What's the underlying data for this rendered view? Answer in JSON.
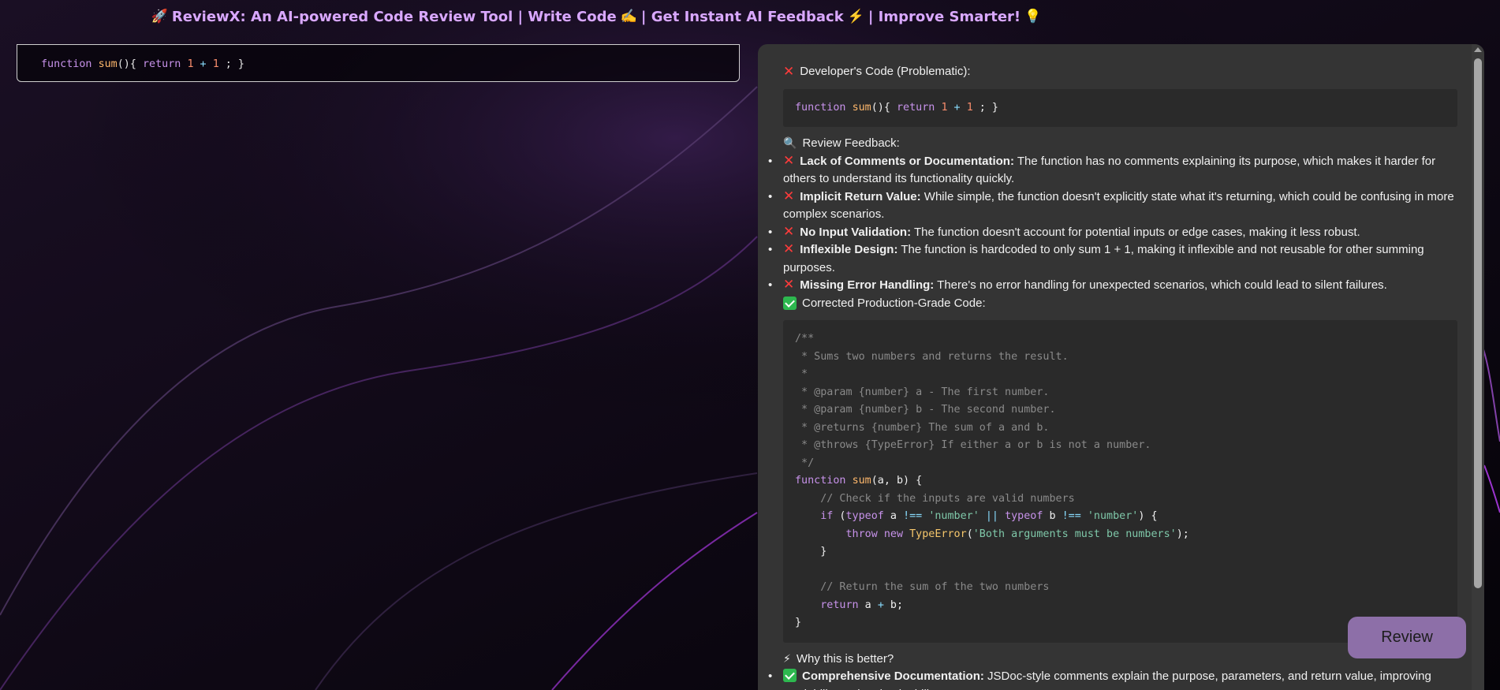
{
  "header": {
    "rocket_icon": "🚀",
    "title_text": "ReviewX: An AI-powered Code Review Tool | Write Code",
    "writing_icon": "✍️",
    "feedback_text": "| Get Instant AI Feedback",
    "lightning_icon": "⚡",
    "improve_text": "| Improve Smarter!",
    "bulb_icon": "💡"
  },
  "editor": {
    "code_tokens": [
      "function ",
      "sum",
      "(){ ",
      "return ",
      "1",
      " + ",
      "1",
      " ; }"
    ]
  },
  "review": {
    "developers_code_heading": "Developer's Code (Problematic):",
    "developers_code_tokens": [
      "function ",
      "sum",
      "(){ ",
      "return ",
      "1",
      " + ",
      "1",
      " ; }"
    ],
    "feedback_heading": "Review Feedback:",
    "issues": [
      {
        "title": "Lack of Comments or Documentation:",
        "text": " The function has no comments explaining its purpose, which makes it harder for others to understand its functionality quickly."
      },
      {
        "title": "Implicit Return Value:",
        "text": " While simple, the function doesn't explicitly state what it's returning, which could be confusing in more complex scenarios."
      },
      {
        "title": "No Input Validation:",
        "text": " The function doesn't account for potential inputs or edge cases, making it less robust."
      },
      {
        "title": "Inflexible Design:",
        "text": " The function is hardcoded to only sum 1 + 1, making it inflexible and not reusable for other summing purposes."
      },
      {
        "title": "Missing Error Handling:",
        "text": " There's no error handling for unexpected scenarios, which could lead to silent failures."
      }
    ],
    "corrected_heading": "Corrected Production-Grade Code:",
    "corrected_code": {
      "l1": "/**",
      "l2": " * Sums two numbers and returns the result.",
      "l3": " *",
      "l4": " * @param {number} a - The first number.",
      "l5": " * @param {number} b - The second number.",
      "l6": " * @returns {number} The sum of a and b.",
      "l7": " * @throws {TypeError} If either a or b is not a number.",
      "l8": " */",
      "l9": [
        "function ",
        "sum",
        "(a, b) {"
      ],
      "l10": "    // Check if the inputs are valid numbers",
      "l11": [
        "    ",
        "if",
        " (",
        "typeof",
        " a ",
        "!==",
        " ",
        "'number'",
        " ",
        "||",
        " ",
        "typeof",
        " b ",
        "!==",
        " ",
        "'number'",
        ") {"
      ],
      "l12": [
        "        ",
        "throw",
        " ",
        "new",
        " ",
        "TypeError",
        "(",
        "'Both arguments must be numbers'",
        ");"
      ],
      "l13": "    }",
      "l14": "",
      "l15": "    // Return the sum of the two numbers",
      "l16": [
        "    ",
        "return",
        " a ",
        "+",
        " b;"
      ],
      "l17": "}"
    },
    "why_heading": "Why this is better?",
    "benefits": [
      {
        "title": "Comprehensive Documentation:",
        "text": " JSDoc-style comments explain the purpose, parameters, and return value, improving readability and maintainability."
      }
    ]
  },
  "buttons": {
    "review_label": "Review"
  },
  "icons": {
    "magnifier": "🔍",
    "lightning": "⚡"
  }
}
